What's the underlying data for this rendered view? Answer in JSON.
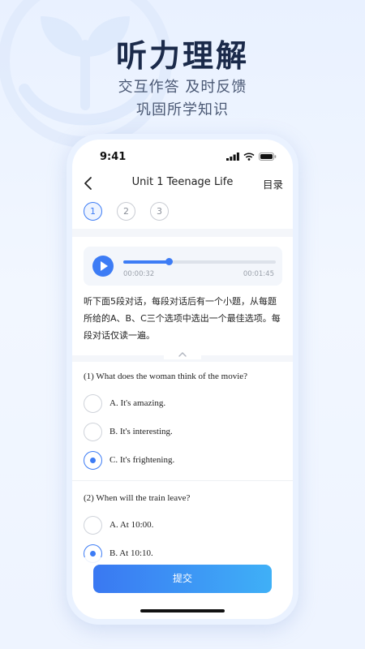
{
  "promo": {
    "headline": "听力理解",
    "subline1": "交互作答  及时反馈",
    "subline2": "巩固所学知识"
  },
  "status_bar": {
    "time": "9:41"
  },
  "nav": {
    "title": "Unit 1 Teenage Life",
    "menu_label": "目录"
  },
  "steps": [
    "1",
    "2",
    "3"
  ],
  "active_step": 0,
  "player": {
    "current": "00:00:32",
    "total": "00:01:45",
    "progress": 0.3
  },
  "instructions": "听下面5段对话，每段对话后有一个小题，从每题所给的A、B、C三个选项中选出一个最佳选项。每段对话仅读一遍。",
  "questions": [
    {
      "prompt": "(1) What does the woman think of the movie?",
      "options": [
        "A. It's amazing.",
        "B. It's interesting.",
        "C. It's frightening."
      ],
      "selected": 2
    },
    {
      "prompt": "(2) When will the train leave?",
      "options": [
        "A. At 10:00.",
        "B. At 10:10."
      ],
      "selected": 1
    }
  ],
  "submit_label": "提交",
  "colors": {
    "accent": "#3d7cf5",
    "accent_end": "#3fb0f7",
    "headline": "#1b2a4a"
  }
}
